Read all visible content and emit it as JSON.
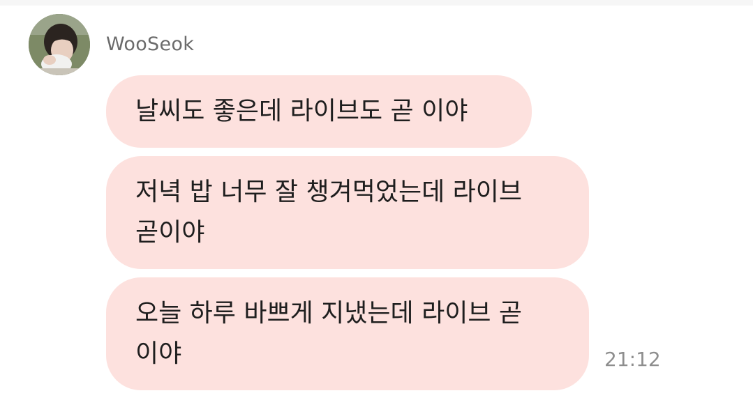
{
  "chat": {
    "sender": {
      "name": "WooSeok",
      "avatar_icon": "profile-photo"
    },
    "messages": [
      {
        "lines": [
          "날씨도 좋은데 라이브도 곧 이야"
        ]
      },
      {
        "lines": [
          "저녁 밥 너무 잘 챙겨먹었는데 라이브",
          "곧이야"
        ]
      },
      {
        "lines": [
          "오늘 하루 바쁘게 지냈는데 라이브 곧",
          "이야"
        ]
      }
    ],
    "timestamp": "21:12",
    "colors": {
      "bubble": "#fde1de",
      "text": "#1e1e1e",
      "name": "#6b6b6b",
      "time": "#8e8e8e"
    }
  }
}
